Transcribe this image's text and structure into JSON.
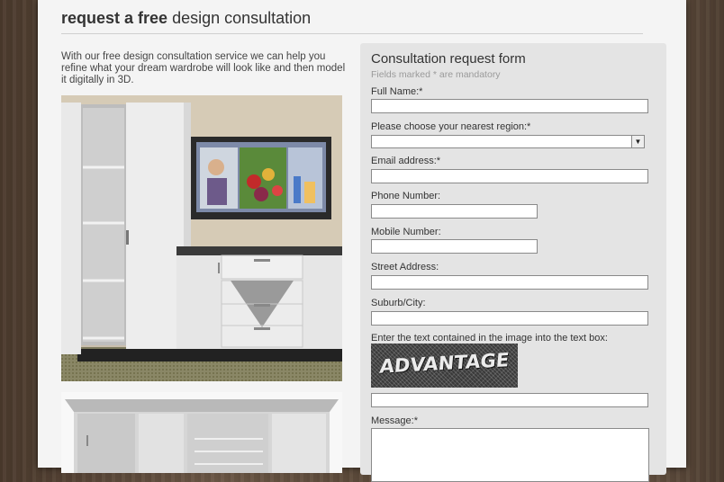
{
  "page": {
    "title_bold": "request a free",
    "title_rest": "design consultation",
    "intro": "With our free design consultation service we can help you refine what your dream wardrobe will look like and then model it digitally in 3D."
  },
  "form": {
    "heading": "Consultation request form",
    "mandatory_note": "Fields marked * are mandatory",
    "full_name_label": "Full Name:*",
    "region_label": "Please choose your nearest region:*",
    "region_value": "",
    "email_label": "Email address:*",
    "phone_label": "Phone Number:",
    "mobile_label": "Mobile Number:",
    "street_label": "Street Address:",
    "suburb_label": "Suburb/City:",
    "captcha_label": "Enter the text contained in the image into the text box:",
    "captcha_text": "ADVANTAGE",
    "message_label": "Message:*"
  },
  "icons": {
    "select_arrow": "chevron-down-icon"
  },
  "colors": {
    "panel": "#f4f4f4",
    "form_bg": "#e4e4e4",
    "wood": "#5a4838"
  }
}
